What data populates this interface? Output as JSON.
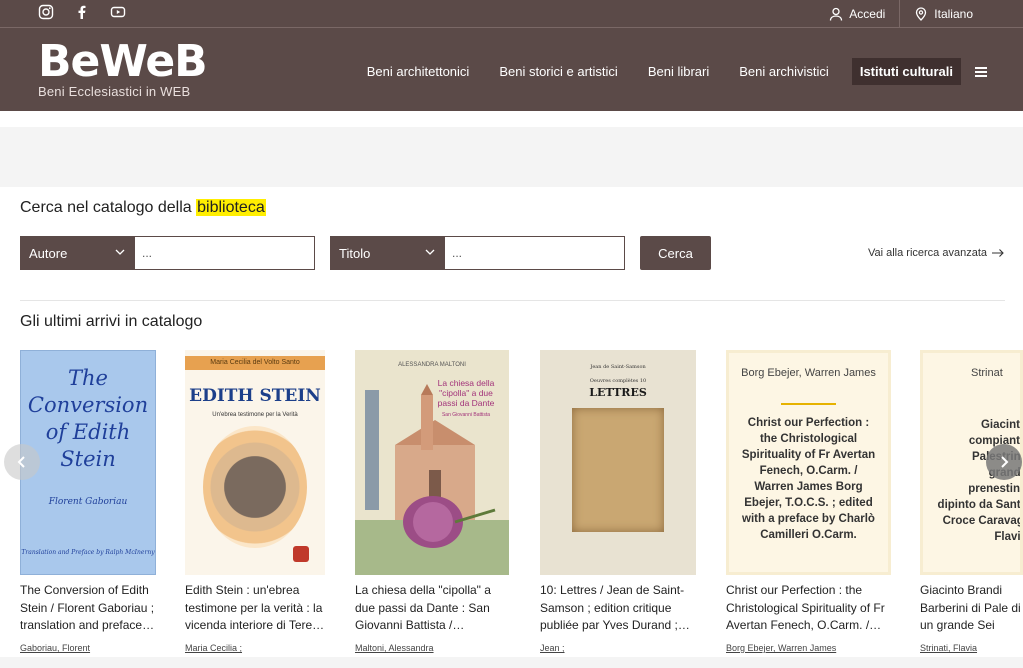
{
  "topbar": {
    "social_icons": [
      "instagram-icon",
      "facebook-icon",
      "youtube-icon"
    ],
    "login_label": "Accedi",
    "language_label": "Italiano"
  },
  "header": {
    "logo_text": "BeWeB",
    "logo_subtitle": "Beni Ecclesiastici in WEB",
    "nav": [
      {
        "label": "Beni architettonici"
      },
      {
        "label": "Beni storici e artistici"
      },
      {
        "label": "Beni librari"
      },
      {
        "label": "Beni archivistici"
      },
      {
        "label": "Istituti culturali",
        "active": true
      }
    ]
  },
  "search": {
    "title_prefix": "Cerca nel catalogo della ",
    "title_highlight": "biblioteca",
    "field1_select": "Autore",
    "field1_placeholder": "...",
    "field2_select": "Titolo",
    "field2_placeholder": "...",
    "button_label": "Cerca",
    "advanced_link": "Vai alla ricerca avanzata"
  },
  "latest": {
    "title": "Gli ultimi arrivi in catalogo",
    "items": [
      {
        "title": "The Conversion of Edith Stein / Florent Gaboriau ; translation and preface…",
        "author": "Gaboriau, Florent",
        "cover_lines": [
          "The",
          "Conversion",
          "of Edith",
          "Stein"
        ],
        "cover_author": "Florent Gaboriau",
        "cover_footer": "Translation and Preface by Ralph McInerny"
      },
      {
        "title": "Edith Stein : un'ebrea testimone per la verità : la vicenda interiore di Tere…",
        "author": "Maria Cecilia ;",
        "cover_top": "Maria Cecilia del Volto Santo",
        "cover_title": "EDITH STEIN",
        "cover_sub": "Un'ebrea testimone per la Verità"
      },
      {
        "title": "La chiesa della \"cipolla\" a due passi da Dante : San Giovanni Battista /…",
        "author": "Maltoni, Alessandra",
        "cover_top": "ALESSANDRA MALTONI",
        "cover_title": "La chiesa della \"cipolla\" a due passi da Dante",
        "cover_sub": "San Giovanni Battista"
      },
      {
        "title": "10: Lettres / Jean de Saint-Samson ; edition critique publiée par Yves Durand ;…",
        "author": "Jean ;",
        "cover_top": "Jean de Saint-Samson",
        "cover_sub": "Oeuvres complètes 10",
        "cover_title": "LETTRES"
      },
      {
        "title": "Christ our Perfection : the Christological Spirituality of Fr Avertan Fenech, O.Carm. /…",
        "author": "Borg Ebejer, Warren James",
        "cover_author": "Borg Ebejer, Warren James",
        "cover_text": "Christ our Perfection : the Christological Spirituality of Fr Avertan Fenech, O.Carm. / Warren James Borg Ebejer, T.O.C.S. ; edited with a preface by Charlò Camilleri O.Carm."
      },
      {
        "title": "Giacinto Brandi Barberini di Pale di un grande Sei",
        "author": "Strinati, Flavia",
        "cover_author": "Strinat",
        "cover_text": "Giacinto compianto Palestrina grande prenestino dipinto da Santa Croce Caravagi Flavia"
      }
    ]
  },
  "colors": {
    "brand": "#5b4a48",
    "brand_dark": "#3f302f",
    "highlight": "#ffee00"
  }
}
